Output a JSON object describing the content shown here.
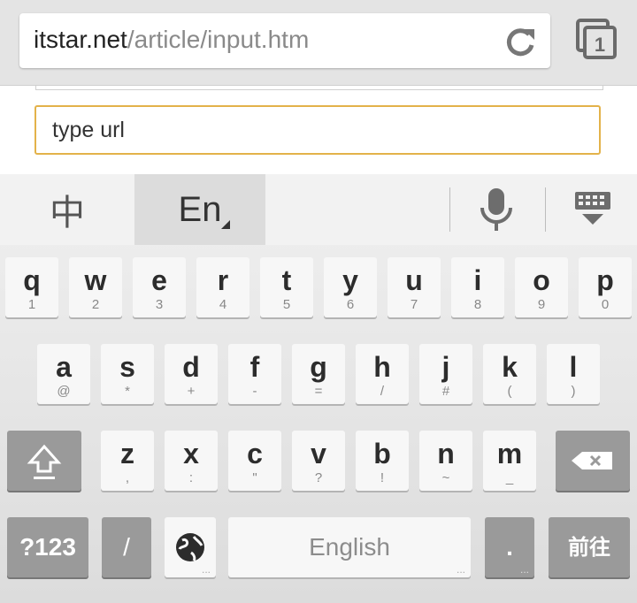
{
  "browser": {
    "url_host": "itstar.net",
    "url_path": "/article/input.htm",
    "tab_count": "1",
    "icons": {
      "reload": "reload-icon",
      "tabs": "tabs-switcher-icon"
    }
  },
  "page": {
    "url_input_value": "type url"
  },
  "keyboard": {
    "lang_chinese": "中",
    "lang_english": "En",
    "row1": [
      {
        "main": "q",
        "sub": "1"
      },
      {
        "main": "w",
        "sub": "2"
      },
      {
        "main": "e",
        "sub": "3"
      },
      {
        "main": "r",
        "sub": "4"
      },
      {
        "main": "t",
        "sub": "5"
      },
      {
        "main": "y",
        "sub": "6"
      },
      {
        "main": "u",
        "sub": "7"
      },
      {
        "main": "i",
        "sub": "8"
      },
      {
        "main": "o",
        "sub": "9"
      },
      {
        "main": "p",
        "sub": "0"
      }
    ],
    "row2": [
      {
        "main": "a",
        "sub": "@"
      },
      {
        "main": "s",
        "sub": "*"
      },
      {
        "main": "d",
        "sub": "+"
      },
      {
        "main": "f",
        "sub": "-"
      },
      {
        "main": "g",
        "sub": "="
      },
      {
        "main": "h",
        "sub": "/"
      },
      {
        "main": "j",
        "sub": "#"
      },
      {
        "main": "k",
        "sub": "("
      },
      {
        "main": "l",
        "sub": ")"
      }
    ],
    "row3": [
      {
        "main": "z",
        "sub": ","
      },
      {
        "main": "x",
        "sub": ":"
      },
      {
        "main": "c",
        "sub": "\""
      },
      {
        "main": "v",
        "sub": "?"
      },
      {
        "main": "b",
        "sub": "!"
      },
      {
        "main": "n",
        "sub": "~"
      },
      {
        "main": "m",
        "sub": "_"
      }
    ],
    "symbols_key": "?123",
    "slash_key": "/",
    "space_label": "English",
    "period_key": ".",
    "go_key": "前往",
    "icons": {
      "mic": "microphone-icon",
      "hide": "hide-keyboard-icon",
      "shift": "shift-icon",
      "delete": "backspace-icon",
      "globe": "globe-icon"
    }
  },
  "colors": {
    "input_focus_border": "#e3b24a",
    "dark_key": "#9a9a9a"
  }
}
